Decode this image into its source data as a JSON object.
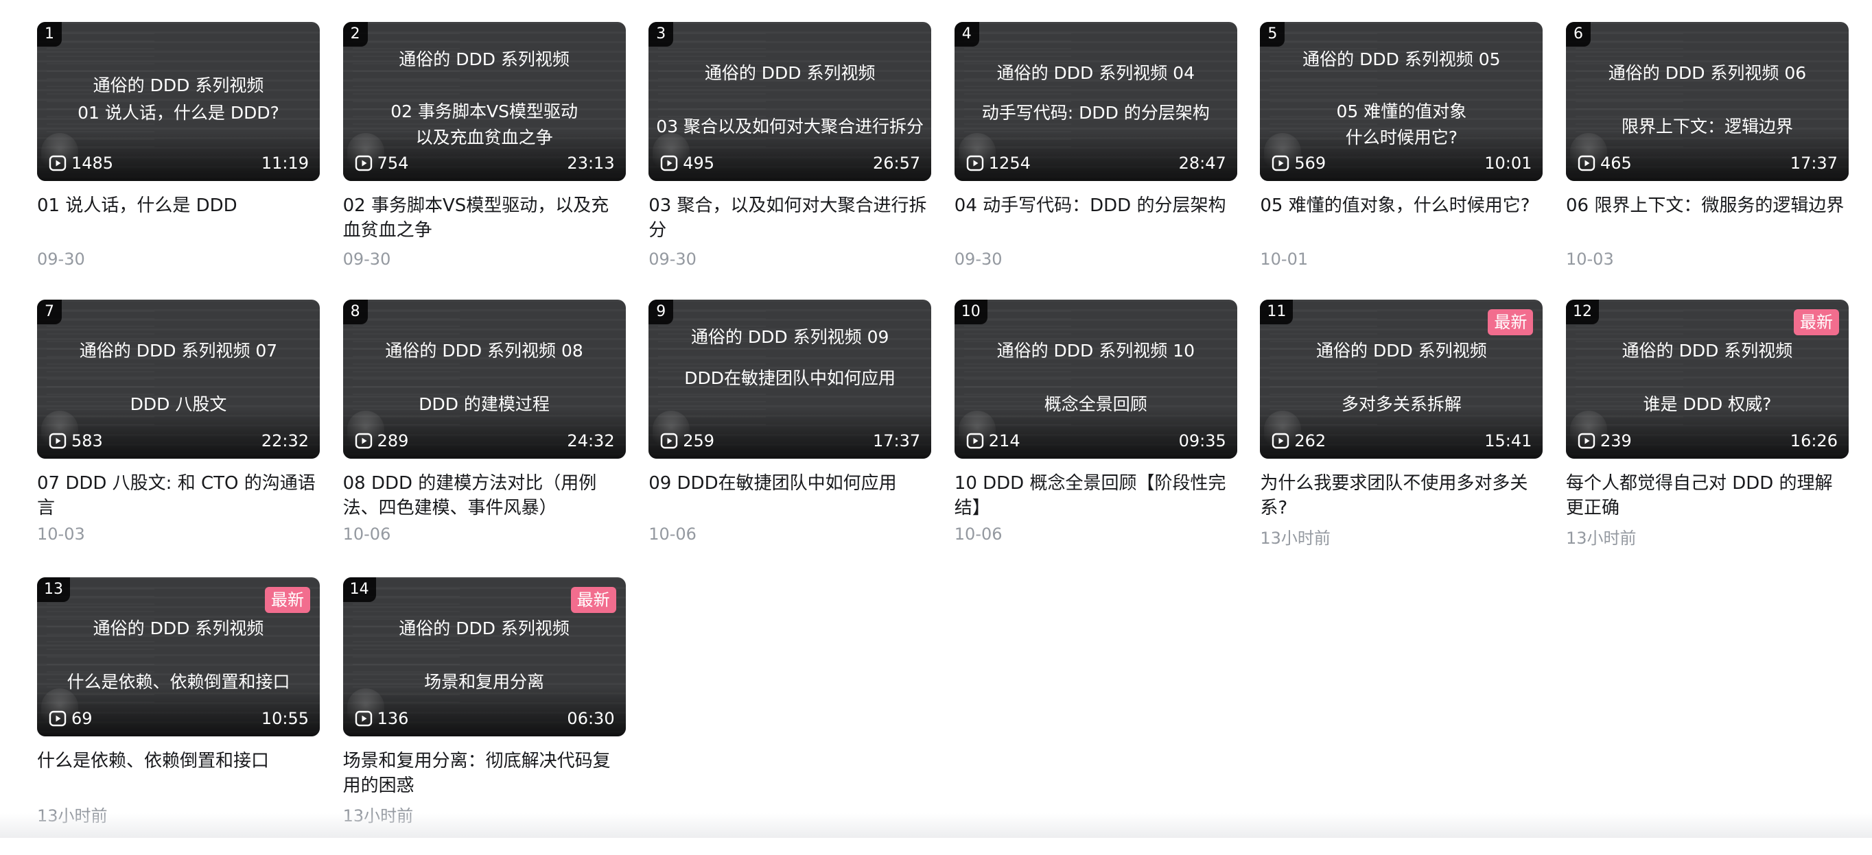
{
  "labels": {
    "new_badge": "最新"
  },
  "videos": [
    {
      "index": "1",
      "thumb_line1": "通俗的 DDD 系列视频",
      "thumb_line2": "01 说人话，什么是 DDD?",
      "views": "1485",
      "duration": "11:19",
      "title": "01 说人话，什么是 DDD",
      "date": "09-30",
      "is_new": false
    },
    {
      "index": "2",
      "thumb_line1": "通俗的 DDD 系列视频",
      "thumb_line2": "02 事务脚本VS模型驱动\n以及充血贫血之争",
      "views": "754",
      "duration": "23:13",
      "title": "02 事务脚本VS模型驱动，以及充血贫血之争",
      "date": "09-30",
      "is_new": false
    },
    {
      "index": "3",
      "thumb_line1": "通俗的 DDD 系列视频",
      "thumb_line2": "03 聚合以及如何对大聚合进行拆分",
      "views": "495",
      "duration": "26:57",
      "title": "03 聚合，以及如何对大聚合进行拆分",
      "date": "09-30",
      "is_new": false
    },
    {
      "index": "4",
      "thumb_line1": "通俗的 DDD 系列视频 04",
      "thumb_line2": "动手写代码: DDD 的分层架构",
      "views": "1254",
      "duration": "28:47",
      "title": "04 动手写代码：DDD 的分层架构",
      "date": "09-30",
      "is_new": false
    },
    {
      "index": "5",
      "thumb_line1": "通俗的 DDD 系列视频 05",
      "thumb_line2": "05 难懂的值对象\n什么时候用它?",
      "views": "569",
      "duration": "10:01",
      "title": "05 难懂的值对象，什么时候用它?",
      "date": "10-01",
      "is_new": false
    },
    {
      "index": "6",
      "thumb_line1": "通俗的 DDD 系列视频 06",
      "thumb_line2": "限界上下文：逻辑边界",
      "views": "465",
      "duration": "17:37",
      "title": "06 限界上下文：微服务的逻辑边界",
      "date": "10-03",
      "is_new": false
    },
    {
      "index": "7",
      "thumb_line1": "通俗的 DDD 系列视频 07",
      "thumb_line2": "DDD 八股文",
      "views": "583",
      "duration": "22:32",
      "title": "07 DDD 八股文: 和 CTO 的沟通语言",
      "date": "10-03",
      "is_new": false
    },
    {
      "index": "8",
      "thumb_line1": "通俗的 DDD 系列视频 08",
      "thumb_line2": "DDD 的建模过程",
      "views": "289",
      "duration": "24:32",
      "title": "08 DDD 的建模方法对比（用例法、四色建模、事件风暴）",
      "date": "10-06",
      "is_new": false
    },
    {
      "index": "9",
      "thumb_line1": "通俗的 DDD 系列视频 09",
      "thumb_line2": "DDD在敏捷团队中如何应用",
      "views": "259",
      "duration": "17:37",
      "title": "09 DDD在敏捷团队中如何应用",
      "date": "10-06",
      "is_new": false
    },
    {
      "index": "10",
      "thumb_line1": "通俗的 DDD 系列视频 10",
      "thumb_line2": "概念全景回顾",
      "views": "214",
      "duration": "09:35",
      "title": "10 DDD 概念全景回顾【阶段性完结】",
      "date": "10-06",
      "is_new": false
    },
    {
      "index": "11",
      "thumb_line1": "通俗的 DDD 系列视频",
      "thumb_line2": "多对多关系拆解",
      "views": "262",
      "duration": "15:41",
      "title": "为什么我要求团队不使用多对多关系?",
      "date": "13小时前",
      "is_new": true
    },
    {
      "index": "12",
      "thumb_line1": "通俗的 DDD 系列视频",
      "thumb_line2": "谁是 DDD 权威?",
      "views": "239",
      "duration": "16:26",
      "title": "每个人都觉得自己对 DDD 的理解更正确",
      "date": "13小时前",
      "is_new": true
    },
    {
      "index": "13",
      "thumb_line1": "通俗的 DDD 系列视频",
      "thumb_line2": "什么是依赖、依赖倒置和接口",
      "views": "69",
      "duration": "10:55",
      "title": "什么是依赖、依赖倒置和接口",
      "date": "13小时前",
      "is_new": true
    },
    {
      "index": "14",
      "thumb_line1": "通俗的 DDD 系列视频",
      "thumb_line2": "场景和复用分离",
      "views": "136",
      "duration": "06:30",
      "title": "场景和复用分离：彻底解决代码复用的困惑",
      "date": "13小时前",
      "is_new": true
    }
  ]
}
